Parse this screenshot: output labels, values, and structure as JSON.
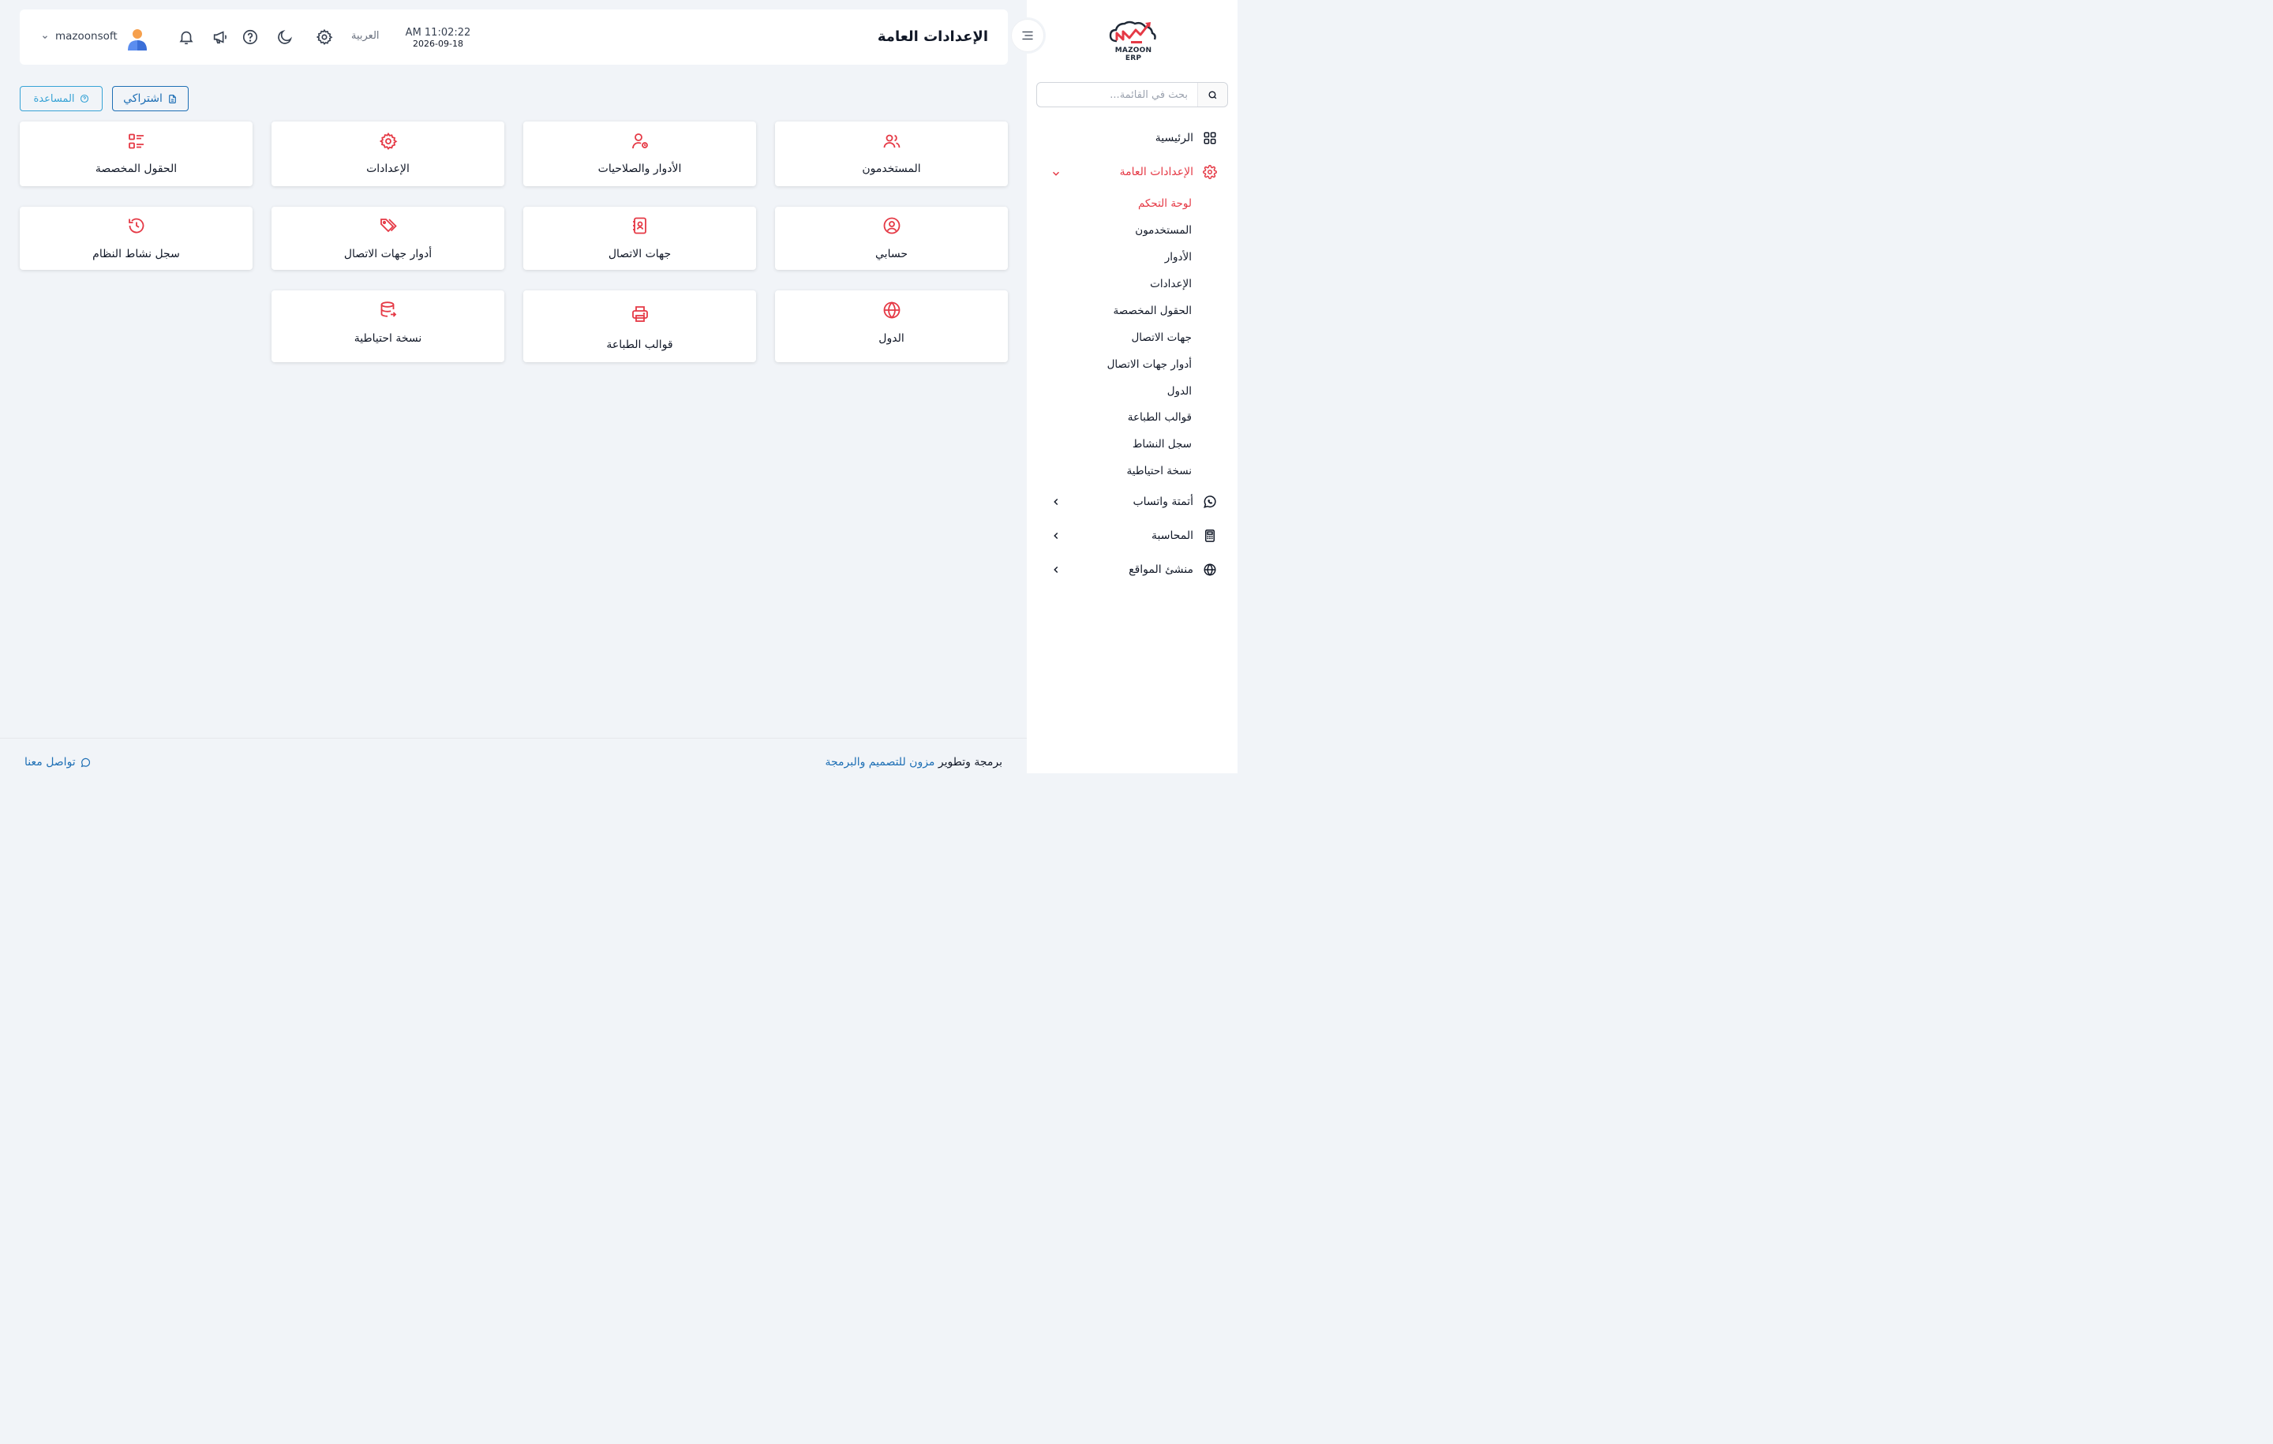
{
  "brand": {
    "logo_text": "MAZOON ERP",
    "accent": "#e53945",
    "primary": "#1e6fb5"
  },
  "header": {
    "title": "الإعدادات العامة",
    "time": "AM 11:02:22",
    "date": "2026-09-18",
    "language": "العربية",
    "username": "mazoonsoft"
  },
  "sidebar": {
    "search_placeholder": "بحث في القائمة...",
    "items": [
      {
        "label": "الرئيسية",
        "icon": "grid-icon"
      },
      {
        "label": "الإعدادات العامة",
        "icon": "gear-icon"
      },
      {
        "label": "أتمتة واتساب",
        "icon": "whatsapp-icon"
      },
      {
        "label": "المحاسبة",
        "icon": "calculator-icon"
      },
      {
        "label": "منشئ المواقع",
        "icon": "globe-icon"
      }
    ],
    "subitems": [
      "لوحة التحكم",
      "المستخدمون",
      "الأدوار",
      "الإعدادات",
      "الحقول المخصصة",
      "جهات الاتصال",
      "أدوار جهات الاتصال",
      "الدول",
      "قوالب الطباعة",
      "سجل النشاط",
      "نسخة احتياطية"
    ]
  },
  "actions": {
    "subscription": "اشتراكي",
    "help": "المساعدة"
  },
  "cards": [
    {
      "label": "المستخدمون",
      "icon": "users-icon"
    },
    {
      "label": "الأدوار والصلاحيات",
      "icon": "user-shield-icon"
    },
    {
      "label": "الإعدادات",
      "icon": "gear-icon"
    },
    {
      "label": "الحقول المخصصة",
      "icon": "list-icon"
    },
    {
      "label": "حسابي",
      "icon": "user-circle-icon"
    },
    {
      "label": "جهات الاتصال",
      "icon": "contact-book-icon"
    },
    {
      "label": "أدوار جهات الاتصال",
      "icon": "tags-icon"
    },
    {
      "label": "سجل نشاط النظام",
      "icon": "history-icon"
    },
    {
      "label": "الدول",
      "icon": "globe-icon"
    },
    {
      "label": "قوالب الطباعة",
      "icon": "printer-icon"
    },
    {
      "label": "نسخة احتياطية",
      "icon": "database-icon"
    }
  ],
  "footer": {
    "credit_prefix": "برمجة وتطوير",
    "credit_link": "مزون للتصميم والبرمجة",
    "contact": "تواصل معنا"
  }
}
